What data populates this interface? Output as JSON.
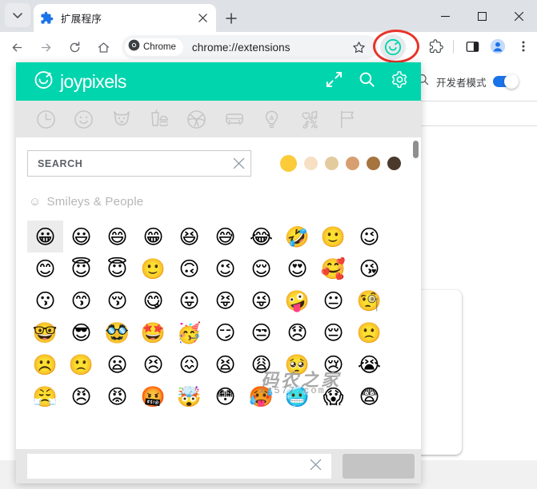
{
  "browser": {
    "tab": {
      "title": "扩展程序",
      "favicon": "puzzle-piece-icon",
      "close_label": "×"
    },
    "newtab_label": "+",
    "window_controls": {
      "minimize": "—",
      "maximize": "□",
      "close": "✕"
    },
    "nav": {
      "back": "←",
      "forward": "→",
      "reload": "↻",
      "home": "⌂"
    },
    "omnibox": {
      "chip_label": "Chrome",
      "url": "chrome://extensions",
      "bookmark": "star-icon"
    },
    "right_icons": [
      "joypixels-extension-icon",
      "extensions-puzzle-icon",
      "side-panel-icon",
      "profile-avatar-icon",
      "more-menu-icon"
    ]
  },
  "extensions_page": {
    "search_icon": "search-icon",
    "developer_mode_label": "开发者模式",
    "developer_mode_on": true,
    "accent_color": "#1a73e8"
  },
  "popup": {
    "brand": "joypixels",
    "header_color": "#00d5ad",
    "actions": [
      {
        "name": "expand-icon",
        "label": "Expand"
      },
      {
        "name": "search-icon",
        "label": "Search"
      },
      {
        "name": "settings-gear-icon",
        "label": "Settings"
      }
    ],
    "categories": [
      {
        "name": "recent",
        "icon": "clock-icon"
      },
      {
        "name": "smileys-people",
        "icon": "smiley-icon"
      },
      {
        "name": "animals-nature",
        "icon": "fox-icon"
      },
      {
        "name": "food-drink",
        "icon": "food-icon"
      },
      {
        "name": "activities",
        "icon": "ball-icon"
      },
      {
        "name": "travel-places",
        "icon": "car-icon"
      },
      {
        "name": "objects",
        "icon": "lightbulb-icon"
      },
      {
        "name": "symbols",
        "icon": "symbols-icon"
      },
      {
        "name": "flags",
        "icon": "flag-icon"
      }
    ],
    "search": {
      "value": "SEARCH",
      "placeholder": "SEARCH",
      "clear_label": "✕"
    },
    "skin_tones": [
      {
        "name": "default",
        "color": "#fbcb39",
        "selected": true
      },
      {
        "name": "light",
        "color": "#f7dfc3",
        "selected": false
      },
      {
        "name": "medium-light",
        "color": "#e3cb9e",
        "selected": false
      },
      {
        "name": "medium",
        "color": "#d79e70",
        "selected": false
      },
      {
        "name": "medium-dark",
        "color": "#a5743f",
        "selected": false
      },
      {
        "name": "dark",
        "color": "#4b3a2c",
        "selected": false
      }
    ],
    "section_title": "Smileys & People",
    "section_title_icon": "☺",
    "emoji_rows": [
      [
        "😀",
        "😃",
        "😄",
        "😁",
        "😆",
        "😅",
        "😂",
        "🤣",
        "🙂",
        "😉"
      ],
      [
        "😊",
        "😇",
        "😇",
        "🙂",
        "🙃",
        "😉",
        "😌",
        "😍",
        "🥰",
        "😘"
      ],
      [
        "😗",
        "😙",
        "😚",
        "😋",
        "😛",
        "😝",
        "😜",
        "🤪",
        "😐",
        "🧐"
      ],
      [
        "🤓",
        "😎",
        "🥸",
        "🤩",
        "🥳",
        "😏",
        "😒",
        "😞",
        "😔",
        "🙁"
      ],
      [
        "☹️",
        "🙁",
        "😦",
        "😣",
        "😖",
        "😫",
        "😩",
        "🥺",
        "😢",
        "😭"
      ],
      [
        "😤",
        "😠",
        "😡",
        "🤬",
        "🤯",
        "😳",
        "🥵",
        "🥶",
        "😱",
        "😨"
      ]
    ],
    "selected_emoji_index": 0,
    "footer": {
      "input_value": "",
      "clear_label": "✕",
      "button_label": ""
    }
  },
  "watermark": {
    "cn": "码农之家",
    "en": "xz577.com"
  }
}
